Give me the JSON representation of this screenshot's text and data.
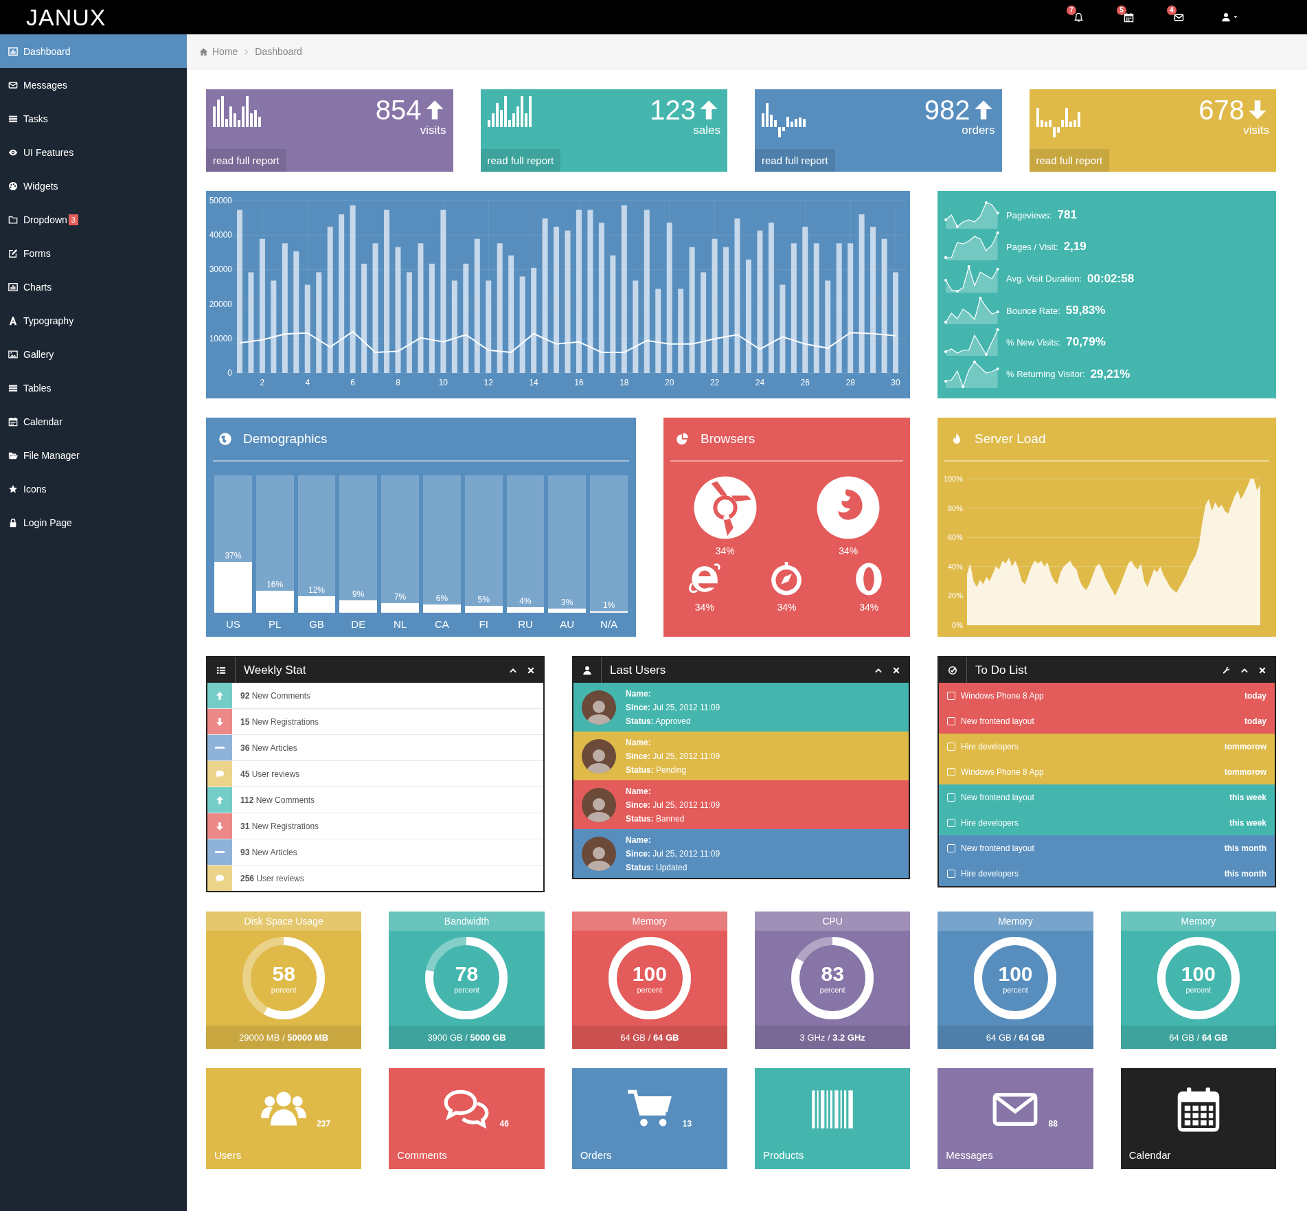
{
  "topbar": {
    "logo": "JANUX",
    "notifications": [
      {
        "kind": "bell",
        "count": "7"
      },
      {
        "kind": "calendar",
        "count": "5"
      },
      {
        "kind": "envelope",
        "count": "4"
      }
    ]
  },
  "sidebar": {
    "items": [
      {
        "kind": "dashboard",
        "label": "Dashboard",
        "selected": true
      },
      {
        "kind": "envelope",
        "label": "Messages",
        "selected": false
      },
      {
        "kind": "tasks",
        "label": "Tasks",
        "selected": false
      },
      {
        "kind": "eye",
        "label": "UI Features",
        "selected": false
      },
      {
        "kind": "palette",
        "label": "Widgets",
        "selected": false
      },
      {
        "kind": "folder",
        "label": "Dropdown",
        "selected": false,
        "badge": "3"
      },
      {
        "kind": "edit",
        "label": "Forms",
        "selected": false
      },
      {
        "kind": "chart",
        "label": "Charts",
        "selected": false
      },
      {
        "kind": "font",
        "label": "Typography",
        "selected": false
      },
      {
        "kind": "picture",
        "label": "Gallery",
        "selected": false
      },
      {
        "kind": "tasks",
        "label": "Tables",
        "selected": false
      },
      {
        "kind": "calendar",
        "label": "Calendar",
        "selected": false
      },
      {
        "kind": "folderopen",
        "label": "File Manager",
        "selected": false
      },
      {
        "kind": "star",
        "label": "Icons",
        "selected": false
      },
      {
        "kind": "lock",
        "label": "Login Page",
        "selected": false
      }
    ]
  },
  "breadcrumb": [
    "Home",
    "Dashboard"
  ],
  "stat_cards": [
    {
      "value": "854",
      "kind": "up",
      "label": "visits",
      "link": "read full report",
      "color": "#8775a7"
    },
    {
      "value": "123",
      "kind": "up",
      "label": "sales",
      "link": "read full report",
      "color": "#44b6ae"
    },
    {
      "value": "982",
      "kind": "up",
      "label": "orders",
      "link": "read full report",
      "color": "#578ebe"
    },
    {
      "value": "678",
      "kind": "down",
      "label": "visits",
      "link": "read full report",
      "color": "#dfba49"
    }
  ],
  "traffic_chart": {
    "chart_data": {
      "type": "bar",
      "x": [
        1,
        1.5,
        2,
        2.5,
        3,
        3.5,
        4,
        4.5,
        5,
        5.5,
        6,
        6.5,
        7,
        7.5,
        8,
        8.5,
        9,
        9.5,
        10,
        10.5,
        11,
        11.5,
        12,
        12.5,
        13,
        13.5,
        14,
        14.5,
        15,
        15.5,
        16,
        16.5,
        17,
        17.5,
        18,
        18.5,
        19,
        19.5,
        20,
        20.5,
        21,
        21.5,
        22,
        22.5,
        23,
        23.5,
        24,
        24.5,
        25,
        25.5,
        26,
        26.5,
        27,
        27.5,
        28,
        28.5,
        29,
        29.5,
        30
      ],
      "series": [
        {
          "color": "#c6d8ea",
          "values": [
            47300,
            29200,
            38900,
            26800,
            37600,
            35300,
            25600,
            29200,
            42400,
            46000,
            48600,
            31700,
            37600,
            47300,
            36500,
            29200,
            37600,
            31700,
            47300,
            26800,
            31700,
            38900,
            26800,
            37600,
            34100,
            28000,
            30500,
            44800,
            42400,
            41300,
            47300,
            47300,
            43600,
            34100,
            48600,
            26800,
            47300,
            24400,
            43600,
            24400,
            36500,
            29200,
            38900,
            36500,
            44800,
            32900,
            41300,
            43600,
            25600,
            37600,
            42400,
            37600,
            26800,
            37600,
            37600,
            46000,
            42400,
            38900,
            29200
          ]
        },
        {
          "type": "line",
          "color": "#ffffff",
          "values": [
            8700,
            null,
            9600,
            null,
            11300,
            null,
            11600,
            null,
            7500,
            null,
            12000,
            null,
            6000,
            null,
            6300,
            null,
            10200,
            null,
            9000,
            null,
            11100,
            null,
            6600,
            null,
            6000,
            null,
            11400,
            null,
            8400,
            null,
            9000,
            null,
            6000,
            null,
            6000,
            null,
            9400,
            null,
            8400,
            null,
            8400,
            null,
            9900,
            null,
            11100,
            null,
            6900,
            null,
            10500,
            null,
            8400,
            null,
            7200,
            null,
            11700,
            null,
            11400,
            null,
            10800
          ]
        }
      ],
      "xlim": [
        0.5,
        30.5
      ],
      "ylim": [
        0,
        50000
      ],
      "grid": true,
      "xticks": [
        2,
        4,
        6,
        8,
        10,
        12,
        14,
        16,
        18,
        20,
        22,
        24,
        26,
        28,
        30
      ],
      "yticks": [
        0,
        10000,
        20000,
        30000,
        40000,
        50000
      ]
    }
  },
  "site_stats": [
    {
      "label": "Pageviews:",
      "value": "781"
    },
    {
      "label": "Pages / Visit:",
      "value": "2,19"
    },
    {
      "label": "Avg. Visit Duration:",
      "value": "00:02:58"
    },
    {
      "label": "Bounce Rate:",
      "value": "59,83%"
    },
    {
      "label": "% New Visits:",
      "value": "70,79%"
    },
    {
      "label": "% Returning Visitor:",
      "value": "29,21%"
    }
  ],
  "demographics": {
    "title": "Demographics",
    "items": [
      {
        "country": "US",
        "percent": "37%",
        "level": 0.37
      },
      {
        "country": "PL",
        "percent": "16%",
        "level": 0.16
      },
      {
        "country": "GB",
        "percent": "12%",
        "level": 0.12
      },
      {
        "country": "DE",
        "percent": "9%",
        "level": 0.09
      },
      {
        "country": "NL",
        "percent": "7%",
        "level": 0.07
      },
      {
        "country": "CA",
        "percent": "6%",
        "level": 0.06
      },
      {
        "country": "FI",
        "percent": "5%",
        "level": 0.05
      },
      {
        "country": "RU",
        "percent": "4%",
        "level": 0.04
      },
      {
        "country": "AU",
        "percent": "3%",
        "level": 0.03
      },
      {
        "country": "N/A",
        "percent": "1%",
        "level": 0.01
      }
    ]
  },
  "browsers": {
    "title": "Browsers",
    "items": [
      {
        "kind": "chrome",
        "percent": "34%"
      },
      {
        "kind": "firefox",
        "percent": "34%"
      },
      {
        "kind": "ie",
        "percent": "34%"
      },
      {
        "kind": "safari",
        "percent": "34%"
      },
      {
        "kind": "opera",
        "percent": "34%"
      }
    ]
  },
  "server_load": {
    "title": "Server Load",
    "chart_data": {
      "type": "area",
      "grid": true,
      "ylim": [
        0,
        100
      ],
      "yticks": [
        {
          "value": 0,
          "label": "0%"
        },
        {
          "value": 20,
          "label": "20%"
        },
        {
          "value": 40,
          "label": "40%"
        },
        {
          "value": 60,
          "label": "60%"
        },
        {
          "value": 80,
          "label": "80%"
        },
        {
          "value": 100,
          "label": "100%"
        }
      ],
      "series": [
        {
          "color": "#fbf4e2",
          "values": [
            35,
            42,
            30,
            26,
            31,
            28,
            33,
            30,
            35,
            40,
            38,
            44,
            42,
            46,
            40,
            44,
            38,
            30,
            28,
            34,
            40,
            44,
            42,
            44,
            40,
            43,
            35,
            30,
            28,
            36,
            40,
            42,
            44,
            40,
            38,
            30,
            26,
            24,
            28,
            34,
            40,
            42,
            38,
            32,
            28,
            24,
            20,
            25,
            30,
            36,
            42,
            44,
            40,
            38,
            42,
            30,
            26,
            32,
            38,
            36,
            40,
            34,
            30,
            26,
            24,
            22,
            26,
            30,
            34,
            40,
            44,
            48,
            55,
            70,
            82,
            86,
            78,
            84,
            80,
            82,
            78,
            76,
            82,
            88,
            92,
            86,
            90,
            95,
            100,
            100,
            92,
            96
          ]
        }
      ]
    }
  },
  "weekly_stat": {
    "title": "Weekly Stat",
    "items": [
      {
        "kind": "up",
        "count": "92",
        "label": "New Comments"
      },
      {
        "kind": "down",
        "count": "15",
        "label": "New Registrations"
      },
      {
        "kind": "minus",
        "count": "36",
        "label": "New Articles"
      },
      {
        "kind": "comment",
        "count": "45",
        "label": "User reviews"
      },
      {
        "kind": "up",
        "count": "112",
        "label": "New Comments"
      },
      {
        "kind": "down",
        "count": "31",
        "label": "New Registrations"
      },
      {
        "kind": "minus",
        "count": "93",
        "label": "New Articles"
      },
      {
        "kind": "comment",
        "count": "256",
        "label": "User reviews"
      }
    ]
  },
  "last_users": {
    "title": "Last Users",
    "users": [
      {
        "name_label": "Name:",
        "since_label": "Since:",
        "since": "Jul 25, 2012 11:09",
        "status_label": "Status:",
        "status": "Approved",
        "color": "#44b6ae"
      },
      {
        "name_label": "Name:",
        "since_label": "Since:",
        "since": "Jul 25, 2012 11:09",
        "status_label": "Status:",
        "status": "Pending",
        "color": "#dfba49"
      },
      {
        "name_label": "Name:",
        "since_label": "Since:",
        "since": "Jul 25, 2012 11:09",
        "status_label": "Status:",
        "status": "Banned",
        "color": "#e35b5a"
      },
      {
        "name_label": "Name:",
        "since_label": "Since:",
        "since": "Jul 25, 2012 11:09",
        "status_label": "Status:",
        "status": "Updated",
        "color": "#578ebe"
      }
    ]
  },
  "todo_list": {
    "title": "To Do List",
    "items": [
      {
        "text": "Windows Phone 8 App",
        "due": "today",
        "checked": false,
        "color": "#e35b5a"
      },
      {
        "text": "New frontend layout",
        "due": "today",
        "checked": false,
        "color": "#e35b5a"
      },
      {
        "text": "Hire developers",
        "due": "tommorow",
        "checked": false,
        "color": "#dfba49"
      },
      {
        "text": "Windows Phone 8 App",
        "due": "tommorow",
        "checked": false,
        "color": "#dfba49"
      },
      {
        "text": "New frontend layout",
        "due": "this week",
        "checked": false,
        "color": "#44b6ae"
      },
      {
        "text": "Hire developers",
        "due": "this week",
        "checked": false,
        "color": "#44b6ae"
      },
      {
        "text": "New frontend layout",
        "due": "this month",
        "checked": false,
        "color": "#578ebe"
      },
      {
        "text": "Hire developers",
        "due": "this month",
        "checked": false,
        "color": "#578ebe"
      }
    ]
  },
  "usage_tiles": [
    {
      "title": "Disk Space Usage",
      "value": "58",
      "unit": "percent",
      "level": 0.58,
      "footer": "29000 MB / **50000 MB**",
      "color": "#dfba49"
    },
    {
      "title": "Bandwidth",
      "value": "78",
      "unit": "percent",
      "level": 0.78,
      "footer": "3900 GB / **5000 GB**",
      "color": "#44b6ae"
    },
    {
      "title": "Memory",
      "value": "100",
      "unit": "percent",
      "level": 1,
      "footer": "64 GB / **64 GB**",
      "color": "#e35b5a"
    },
    {
      "title": "CPU",
      "value": "83",
      "unit": "percent",
      "level": 0.83,
      "footer": "3 GHz / **3.2 GHz**",
      "color": "#8775a7"
    },
    {
      "title": "Memory",
      "value": "100",
      "unit": "percent",
      "level": 1,
      "footer": "64 GB / **64 GB**",
      "color": "#578ebe"
    },
    {
      "title": "Memory",
      "value": "100",
      "unit": "percent",
      "level": 1,
      "footer": "64 GB / **64 GB**",
      "color": "#44b6ae"
    }
  ],
  "shortcut_tiles": [
    {
      "kind": "users",
      "label": "Users",
      "count": "237",
      "color": "#dfba49"
    },
    {
      "kind": "comments",
      "label": "Comments",
      "count": "46",
      "color": "#e35b5a"
    },
    {
      "kind": "cart",
      "label": "Orders",
      "count": "13",
      "color": "#578ebe"
    },
    {
      "kind": "barcode",
      "label": "Products",
      "color": "#44b6ae"
    },
    {
      "kind": "mail",
      "label": "Messages",
      "count": "88",
      "color": "#8775a7"
    },
    {
      "kind": "calendar",
      "label": "Calendar",
      "color": "#222222"
    }
  ]
}
